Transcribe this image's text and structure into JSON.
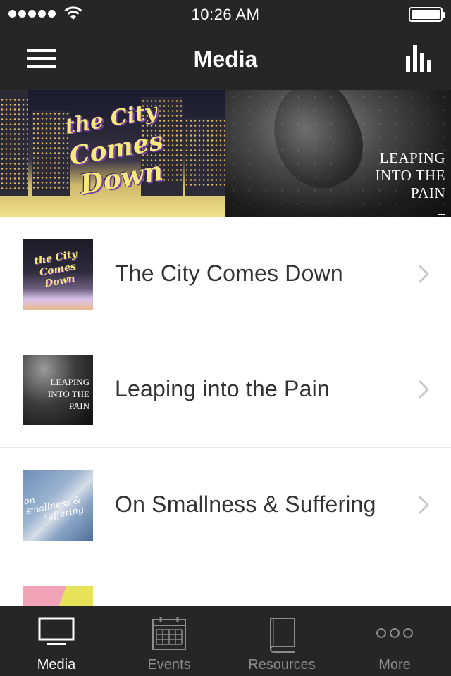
{
  "status_bar": {
    "time": "10:26 AM",
    "signal_bars": 5,
    "battery_level": 1.0
  },
  "nav": {
    "title": "Media",
    "left_icon": "hamburger-menu-icon",
    "right_icon": "bar-chart-icon"
  },
  "hero": [
    {
      "title": "the City Comes Down",
      "lines": [
        "the City",
        "Comes",
        "Down"
      ]
    },
    {
      "title": "LEAPING INTO THE PAIN",
      "lines": [
        "LEAPING",
        "INTO THE",
        "PAIN"
      ]
    }
  ],
  "media_items": [
    {
      "label": "The City Comes Down",
      "thumb_lines": [
        "the City",
        "Comes",
        "Down"
      ]
    },
    {
      "label": "Leaping into the Pain",
      "thumb_lines": [
        "LEAPING",
        "INTO THE",
        "PAIN"
      ]
    },
    {
      "label": "On Smallness & Suffering",
      "thumb_lines": [
        "on",
        "smallness &",
        "suffering"
      ]
    },
    {
      "label": "",
      "thumb_lines": []
    }
  ],
  "tabs": [
    {
      "label": "Media",
      "icon": "tv-icon",
      "active": true
    },
    {
      "label": "Events",
      "icon": "calendar-icon",
      "active": false
    },
    {
      "label": "Resources",
      "icon": "book-icon",
      "active": false
    },
    {
      "label": "More",
      "icon": "more-dots-icon",
      "active": false
    }
  ],
  "colors": {
    "bar_background": "#262626",
    "tab_active": "#ffffff",
    "tab_inactive": "#8c8c8c",
    "chevron": "#c7c7cc"
  }
}
